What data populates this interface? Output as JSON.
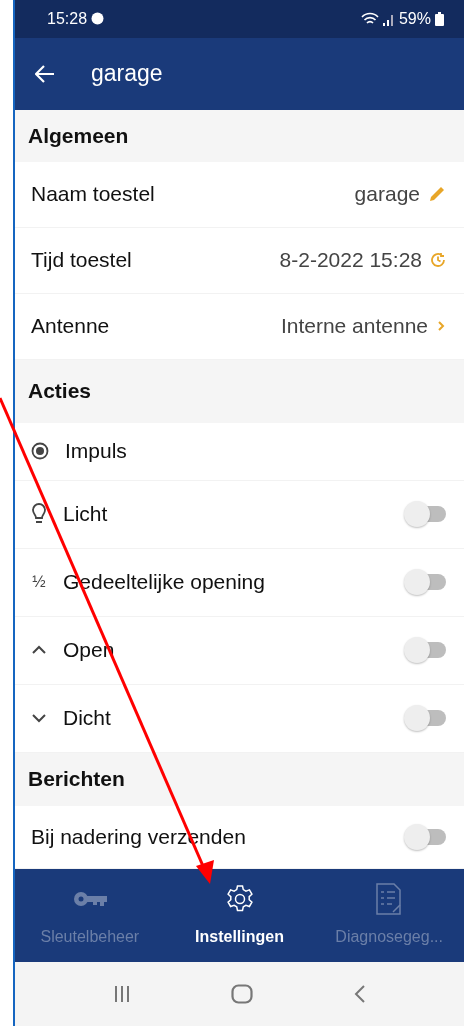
{
  "status_bar": {
    "time": "15:28",
    "battery": "59%"
  },
  "app_bar": {
    "title": "garage"
  },
  "sections": [
    {
      "title": "Algemeen",
      "rows": [
        {
          "kind": "setting",
          "label": "Naam toestel",
          "value": "garage"
        },
        {
          "kind": "setting",
          "label": "Tijd toestel",
          "value": "8-2-2022 15:28"
        },
        {
          "kind": "setting",
          "label": "Antenne",
          "value": "Interne antenne"
        }
      ]
    },
    {
      "title": "Acties",
      "rows": [
        {
          "kind": "radio",
          "label": "Impuls",
          "selected": true
        },
        {
          "kind": "toggle",
          "label": "Licht",
          "on": false
        },
        {
          "kind": "toggle",
          "label": "Gedeeltelijke opening",
          "on": false,
          "symbol": "½"
        },
        {
          "kind": "toggle",
          "label": "Open",
          "on": false
        },
        {
          "kind": "toggle",
          "label": "Dicht",
          "on": false
        }
      ]
    },
    {
      "title": "Berichten",
      "rows": [
        {
          "kind": "toggle",
          "label": "Bij nadering verzenden",
          "on": false
        }
      ]
    }
  ],
  "bottom_nav": [
    {
      "label": "Sleutelbeheer",
      "selected": false
    },
    {
      "label": "Instellingen",
      "selected": true
    },
    {
      "label": "Diagnosegeg...",
      "selected": false
    }
  ]
}
